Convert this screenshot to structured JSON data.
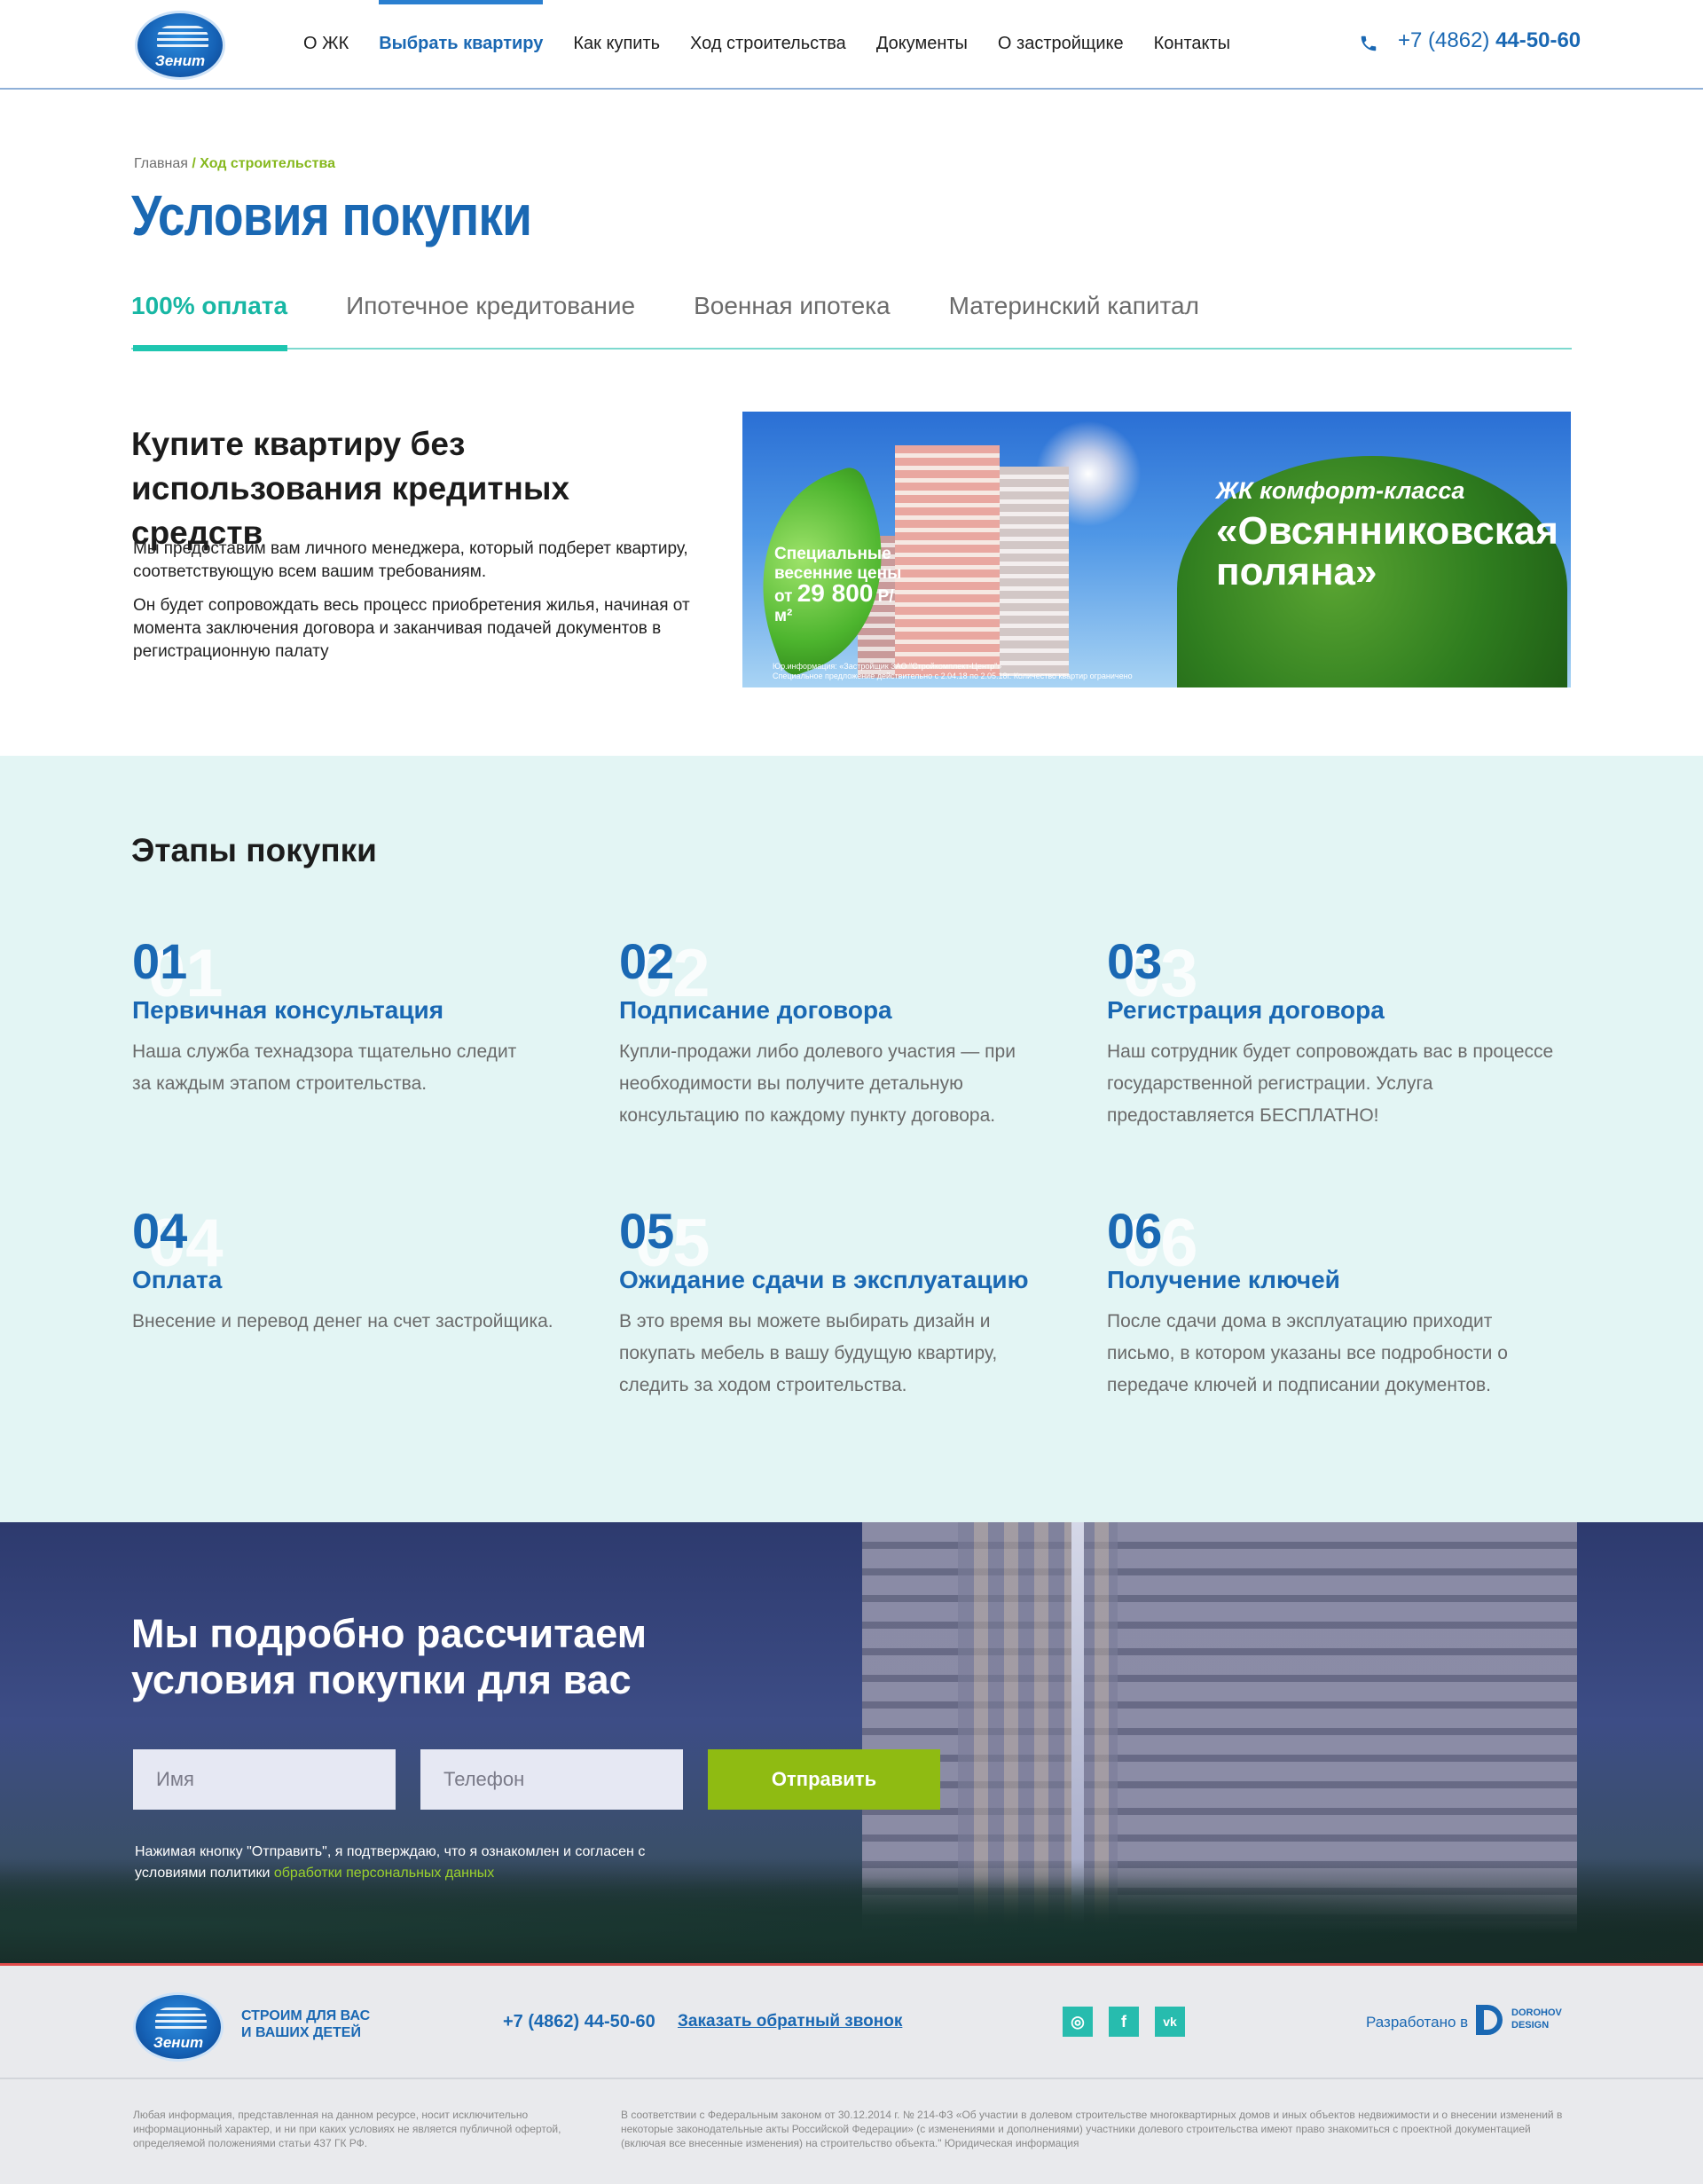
{
  "header": {
    "logo_text": "Зенит",
    "nav": [
      "О ЖК",
      "Выбрать квартиру",
      "Как купить",
      "Ход строительства",
      "Документы",
      "О застройщике",
      "Контакты"
    ],
    "active_nav": "Выбрать квартиру",
    "phone_prefix": "+7 (4862) ",
    "phone_main": "44-50-60",
    "phone_icon": "phone-icon"
  },
  "breadcrumb": {
    "home": "Главная",
    "separator": " / ",
    "current": "Ход строительства"
  },
  "page_title": "Условия покупки",
  "tabs": [
    "100% оплата",
    "Ипотечное кредитование",
    "Военная ипотека",
    "Материнский капитал"
  ],
  "active_tab": "100% оплата",
  "intro": {
    "heading": "Купите квартиру без использования кредитных средств",
    "p1": "Мы предоставим вам личного менеджера, который подберет квартиру, соответствующую всем вашим требованиям.",
    "p2": "Он будет сопровождать весь процесс приобретения жилья, начиная от момента заключения договора и заканчивая подачей документов в регистрационную палату"
  },
  "banner": {
    "offer_line1": "Специальные",
    "offer_line2": "весенние цены",
    "offer_prefix": "от",
    "offer_price": "29 800",
    "offer_unit": "Р/м²",
    "class": "ЖК комфорт-класса",
    "name": "«Овсянниковская поляна»",
    "fine1": "Юр.информация: «Застройщик ЗАО \"Стройкомплект-Центр\"»",
    "fine2": "Специальное предложение действительно с 2.04.18 по 2.05.18г. Количество квартир ограничено"
  },
  "stages": {
    "heading": "Этапы покупки",
    "items": [
      {
        "num": "01",
        "title": "Первичная консультация",
        "text": "Наша служба технадзора тщательно следит за каждым этапом строительства."
      },
      {
        "num": "02",
        "title": "Подписание договора",
        "text": "Купли-продажи либо долевого участия — при необходимости вы получите детальную консультацию по каждому пункту договора."
      },
      {
        "num": "03",
        "title": "Регистрация договора",
        "text": "Наш сотрудник будет сопровождать вас в процессе государственной регистрации. Услуга предоставляется БЕСПЛАТНО!"
      },
      {
        "num": "04",
        "title": "Оплата",
        "text": "Внесение и перевод денег на счет застройщика."
      },
      {
        "num": "05",
        "title": "Ожидание сдачи в эксплуатацию",
        "text": "В это время вы можете выбирать дизайн и покупать мебель в вашу будущую квартиру, следить за ходом строительства."
      },
      {
        "num": "06",
        "title": "Получение ключей",
        "text": "После сдачи дома в эксплуатацию приходит письмо, в котором указаны все подробности о передаче ключей и подписании документов."
      }
    ]
  },
  "cta": {
    "heading": "Мы подробно рассчитаем условия покупки для вас",
    "name_placeholder": "Имя",
    "phone_placeholder": "Телефон",
    "submit": "Отправить",
    "note": "Нажимая кнопку \"Отправить\", я подтверждаю, что я ознакомлен и согласен с условиями политики ",
    "note_link": "обработки персональных данных"
  },
  "footer": {
    "logo_text": "Зенит",
    "slogan_line1": "СТРОИМ ДЛЯ ВАС",
    "slogan_line2": "И ВАШИХ ДЕТЕЙ",
    "phone": "+7 (4862) 44-50-60",
    "callback": "Заказать обратный звонок",
    "social": [
      {
        "icon": "instagram-icon",
        "glyph": "◎"
      },
      {
        "icon": "facebook-icon",
        "glyph": "f"
      },
      {
        "icon": "vk-icon",
        "glyph": "vk"
      }
    ],
    "developed_by": "Разработано в",
    "dev_name_line1": "DOROHOV",
    "dev_name_line2": "DESIGN",
    "legal_left": "Любая информация, представленная на данном ресурсе, носит исключительно информационный характер, и ни при каких условиях не является публичной офертой, определяемой положениями статьи 437 ГК РФ.",
    "legal_right": "В соответствии с Федеральным законом от 30.12.2014 г. № 214-ФЗ «Об участии в долевом строительстве многоквартирных домов и иных объектов недвижимости и о внесении изменений в некоторые законодательные акты Российской Федерации» (с изменениями и дополнениями) участники долевого строительства имеют право знакомиться с проектной документацией (включая все внесенные изменения) на строительство объекта.\" Юридическая информация"
  },
  "colors": {
    "brand_blue": "#1a68b3",
    "accent_teal": "#1fc6b0",
    "accent_green": "#8fbb12",
    "stages_bg": "#e3f5f4"
  }
}
